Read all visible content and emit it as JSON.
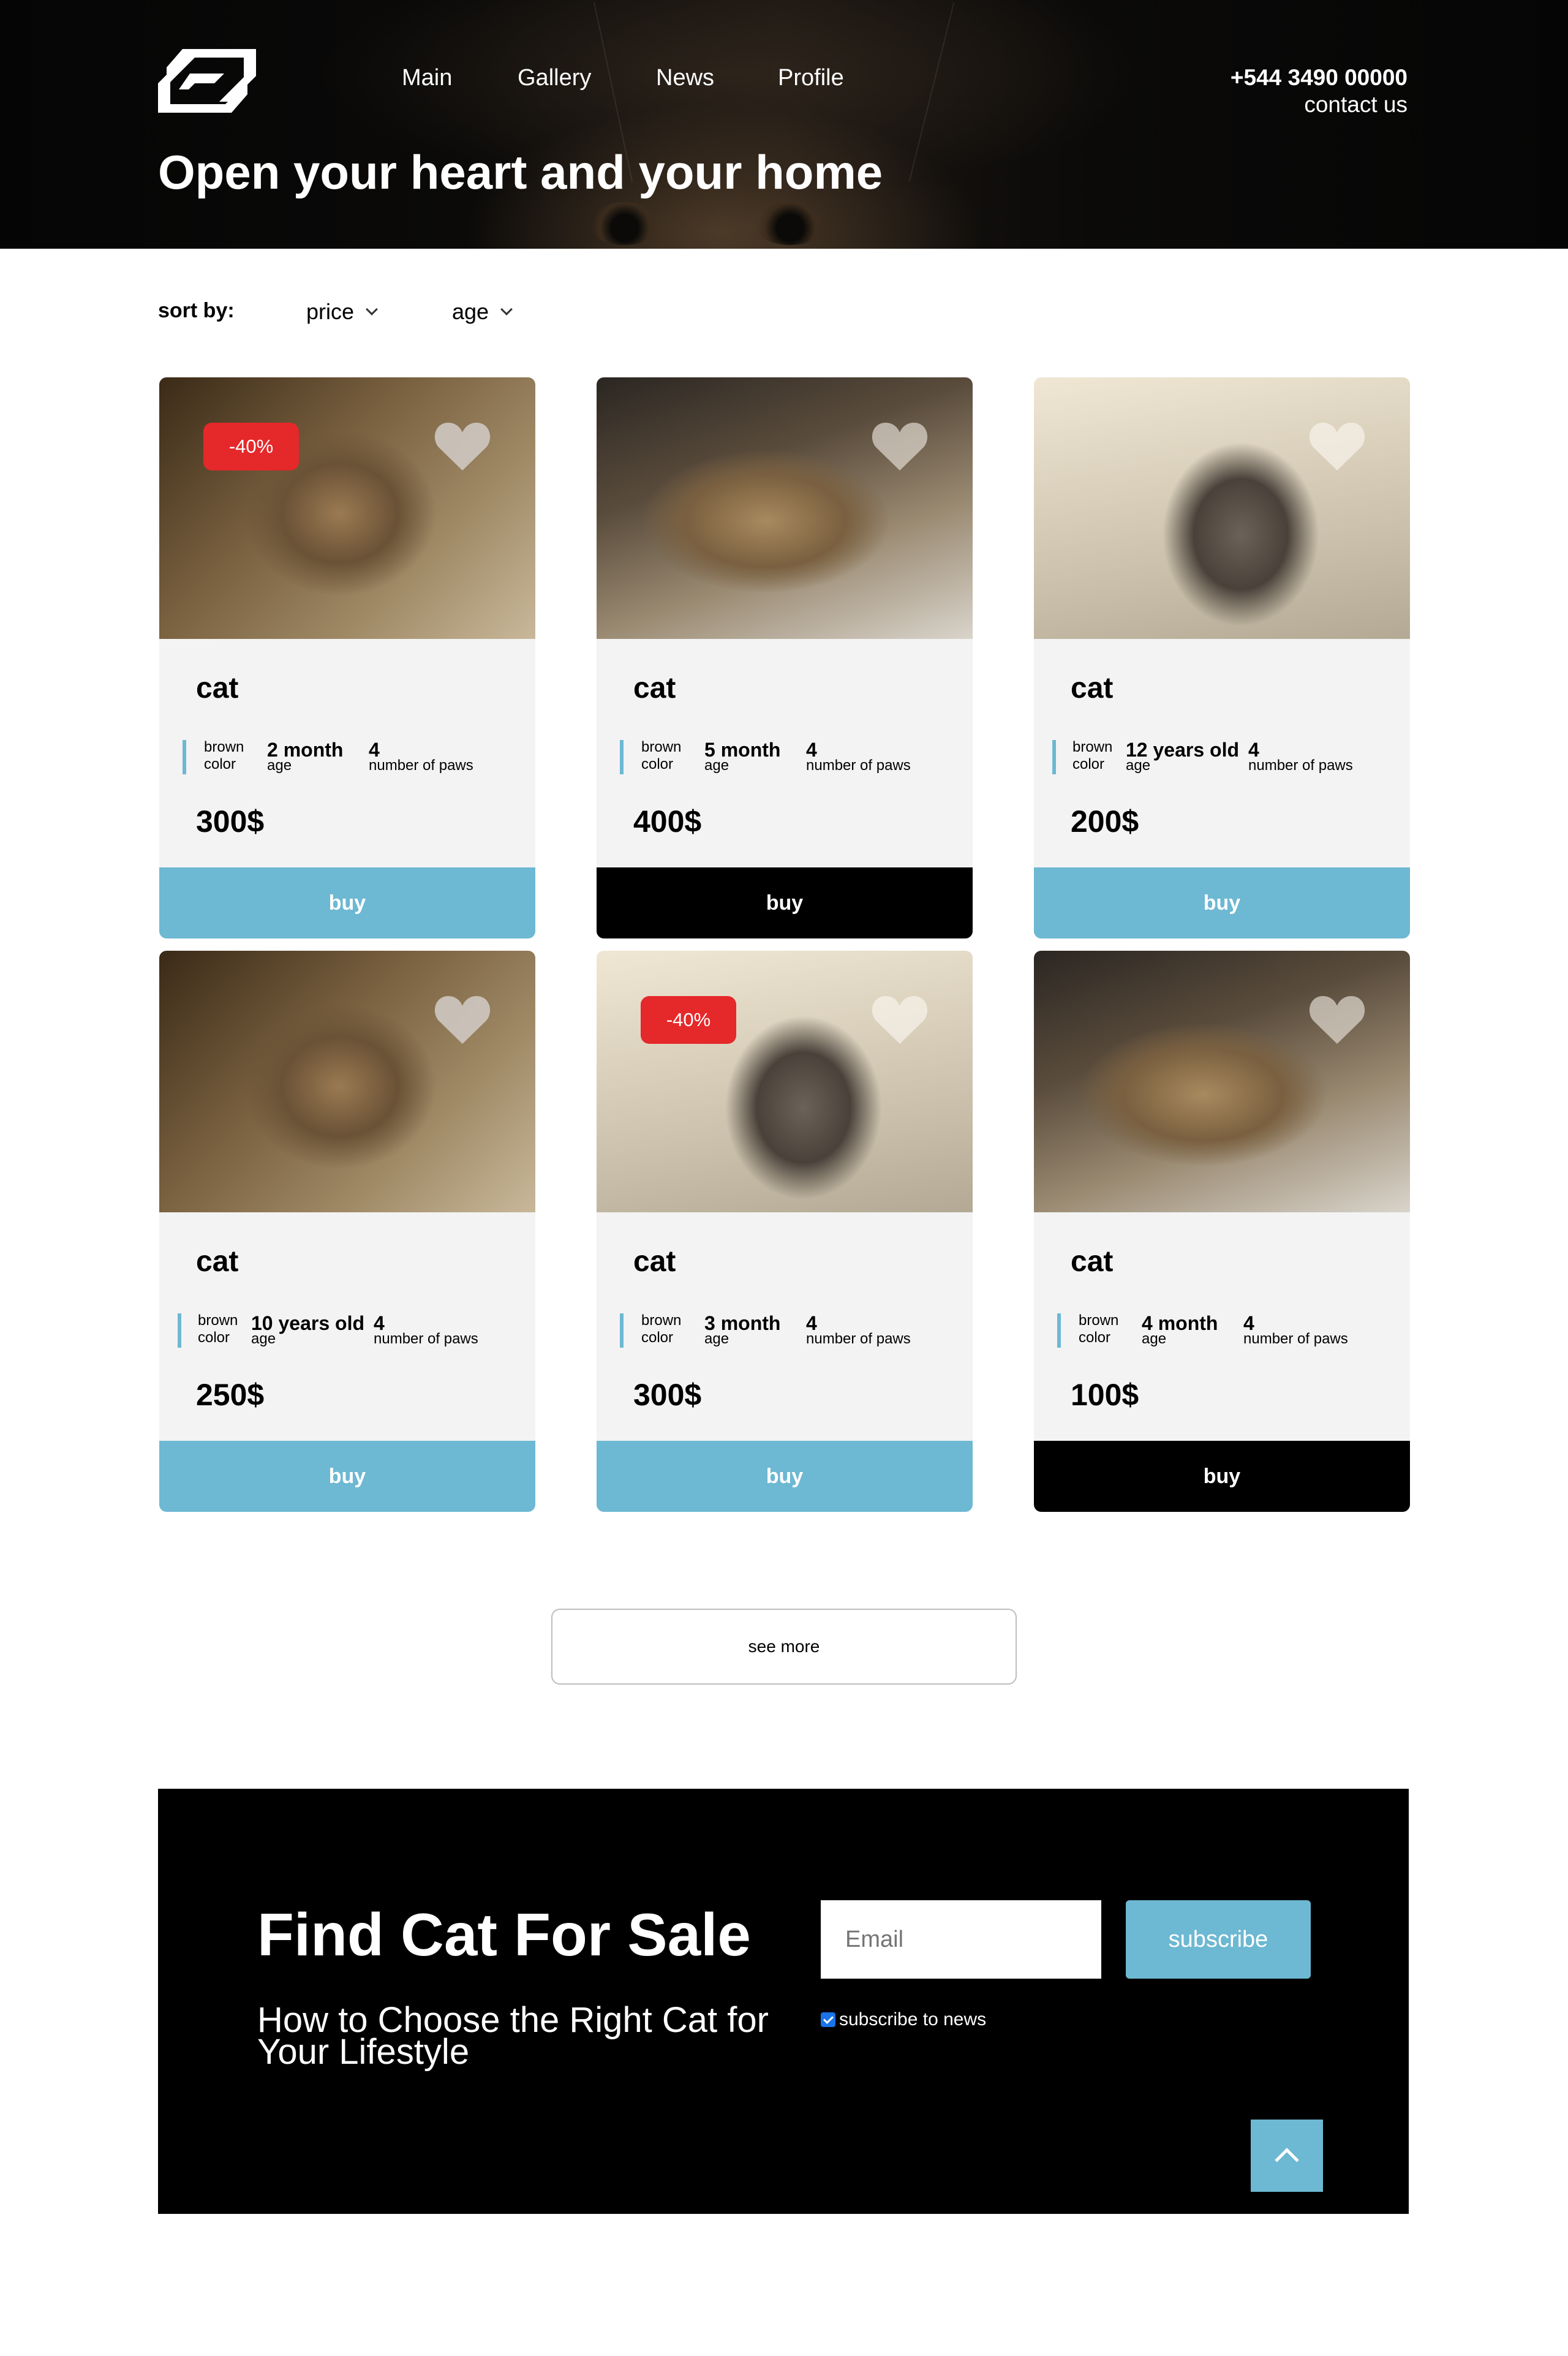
{
  "header": {
    "nav": [
      "Main",
      "Gallery",
      "News",
      "Profile"
    ],
    "phone": "+544 3490 00000",
    "contact": "contact us",
    "title": "Open your heart and your home"
  },
  "sort": {
    "label": "sort by:",
    "options": [
      "price",
      "age"
    ]
  },
  "cards": [
    {
      "name": "cat",
      "color_value": "brown",
      "color_label": "color",
      "age_value": "2 month",
      "age_label": "age",
      "paws_value": "4",
      "paws_label": "number of paws",
      "price": "300$",
      "buy": "buy",
      "badge": "-40%",
      "button_style": "blue"
    },
    {
      "name": "cat",
      "color_value": "brown",
      "color_label": "color",
      "age_value": "5 month",
      "age_label": "age",
      "paws_value": "4",
      "paws_label": "number of paws",
      "price": "400$",
      "buy": "buy",
      "badge": "",
      "button_style": "black"
    },
    {
      "name": "cat",
      "color_value": "brown",
      "color_label": "color",
      "age_value": "12 years old",
      "age_label": "age",
      "paws_value": "4",
      "paws_label": "number of paws",
      "price": "200$",
      "buy": "buy",
      "badge": "",
      "button_style": "blue"
    },
    {
      "name": "cat",
      "color_value": "brown",
      "color_label": "color",
      "age_value": "10 years old",
      "age_label": "age",
      "paws_value": "4",
      "paws_label": "number of paws",
      "price": "250$",
      "buy": "buy",
      "badge": "",
      "button_style": "blue"
    },
    {
      "name": "cat",
      "color_value": "brown",
      "color_label": "color",
      "age_value": "3 month",
      "age_label": "age",
      "paws_value": "4",
      "paws_label": "number of paws",
      "price": "300$",
      "buy": "buy",
      "badge": "-40%",
      "button_style": "blue"
    },
    {
      "name": "cat",
      "color_value": "brown",
      "color_label": "color",
      "age_value": "4 month",
      "age_label": "age",
      "paws_value": "4",
      "paws_label": "number of paws",
      "price": "100$",
      "buy": "buy",
      "badge": "",
      "button_style": "black"
    }
  ],
  "see_more": "see more",
  "footer": {
    "title": "Find Cat For Sale",
    "subtitle": "How to Choose the Right Cat for Your Lifestyle",
    "email_placeholder": "Email",
    "subscribe": "subscribe",
    "checkbox_label": "subscribe to news",
    "checkbox_checked": true
  },
  "colors": {
    "accent": "#6db8d2",
    "badge": "#e5282a",
    "dark": "#000000",
    "card_bg": "#f3f3f3"
  },
  "icons": {
    "logo": "brand-logo-icon",
    "favorite": "heart-icon",
    "sort": "chevron-down-icon",
    "scroll_top": "chevron-up-icon"
  }
}
